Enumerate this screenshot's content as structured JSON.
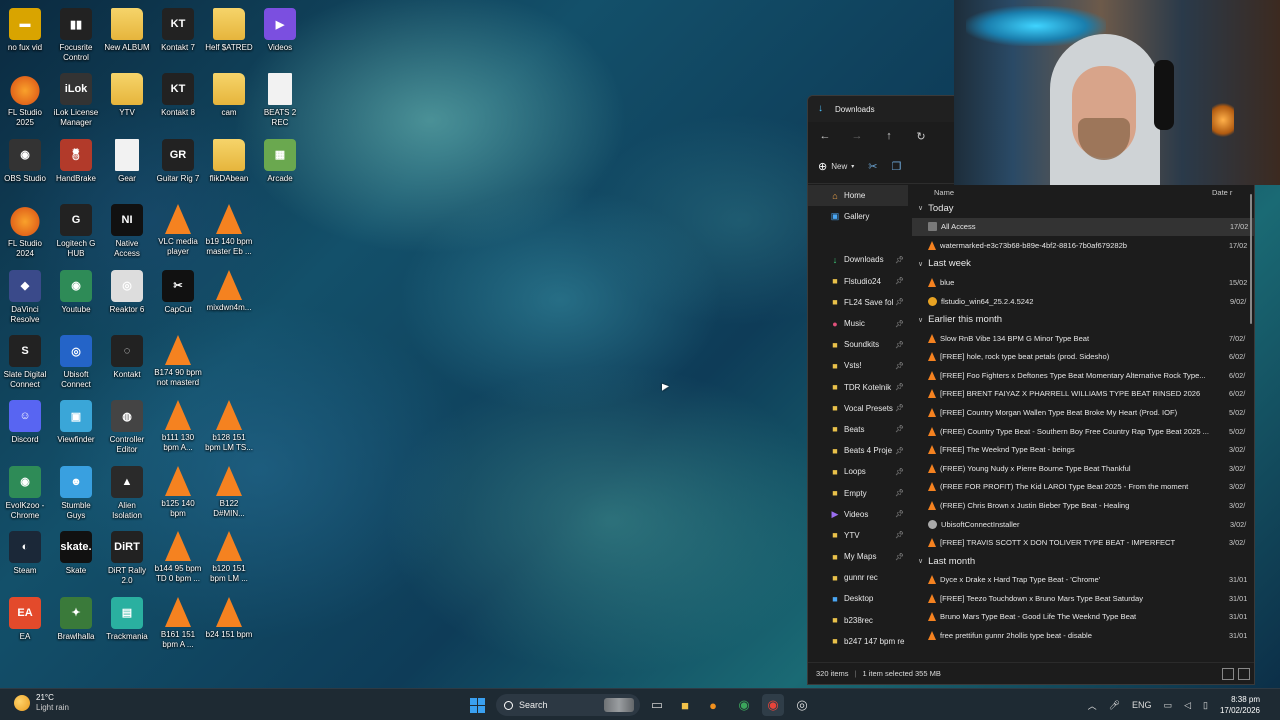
{
  "desktop": {
    "icons": [
      {
        "label": "no fux vid",
        "col": 0,
        "row": 0,
        "kind": "clap"
      },
      {
        "label": "Focusrite\nControl",
        "col": 1,
        "row": 0,
        "kind": "focus"
      },
      {
        "label": "New ALBUM",
        "col": 2,
        "row": 0,
        "kind": "folder"
      },
      {
        "label": "Kontakt 7",
        "col": 3,
        "row": 0,
        "kind": "kt"
      },
      {
        "label": "Helf $ATRED",
        "col": 4,
        "row": 0,
        "kind": "folder"
      },
      {
        "label": "Videos",
        "col": 5,
        "row": 0,
        "kind": "videos"
      },
      {
        "label": "FL Studio\n2025",
        "col": 0,
        "row": 1,
        "kind": "fl"
      },
      {
        "label": "iLok License\nManager",
        "col": 1,
        "row": 1,
        "kind": "ilok"
      },
      {
        "label": "YTV",
        "col": 2,
        "row": 1,
        "kind": "folder"
      },
      {
        "label": "Kontakt 8",
        "col": 3,
        "row": 1,
        "kind": "kt"
      },
      {
        "label": "cam",
        "col": 4,
        "row": 1,
        "kind": "folder"
      },
      {
        "label": "BEATS 2 REC",
        "col": 5,
        "row": 1,
        "kind": "file"
      },
      {
        "label": "OBS Studio",
        "col": 0,
        "row": 2,
        "kind": "obs"
      },
      {
        "label": "HandBrake",
        "col": 1,
        "row": 2,
        "kind": "handbrake"
      },
      {
        "label": "Gear",
        "col": 2,
        "row": 2,
        "kind": "file"
      },
      {
        "label": "Guitar Rig 7",
        "col": 3,
        "row": 2,
        "kind": "gr"
      },
      {
        "label": "flikDAbean",
        "col": 4,
        "row": 2,
        "kind": "folder"
      },
      {
        "label": "Arcade",
        "col": 5,
        "row": 2,
        "kind": "arcade"
      },
      {
        "label": "FL Studio\n2024",
        "col": 0,
        "row": 3,
        "kind": "fl"
      },
      {
        "label": "Logitech G\nHUB",
        "col": 1,
        "row": 3,
        "kind": "ghub"
      },
      {
        "label": "Native\nAccess",
        "col": 2,
        "row": 3,
        "kind": "ni"
      },
      {
        "label": "VLC media\nplayer",
        "col": 3,
        "row": 3,
        "kind": "vlc"
      },
      {
        "label": "b19 140 bpm\nmaster Eb ...",
        "col": 4,
        "row": 3,
        "kind": "vlc"
      },
      {
        "label": "DaVinci\nResolve",
        "col": 0,
        "row": 4,
        "kind": "davinci"
      },
      {
        "label": "Youtube",
        "col": 1,
        "row": 4,
        "kind": "chrome"
      },
      {
        "label": "Reaktor 6",
        "col": 2,
        "row": 4,
        "kind": "reaktor"
      },
      {
        "label": "CapCut",
        "col": 3,
        "row": 4,
        "kind": "capcut"
      },
      {
        "label": "mixdwn4m...",
        "col": 4,
        "row": 4,
        "kind": "vlc"
      },
      {
        "label": "Slate Digital\nConnect",
        "col": 0,
        "row": 5,
        "kind": "slate"
      },
      {
        "label": "Ubisoft\nConnect",
        "col": 1,
        "row": 5,
        "kind": "ubisoft"
      },
      {
        "label": "Kontakt",
        "col": 2,
        "row": 5,
        "kind": "kontakt"
      },
      {
        "label": "B174 90 bpm\nnot masterd",
        "col": 3,
        "row": 5,
        "kind": "vlc"
      },
      {
        "label": "Discord",
        "col": 0,
        "row": 6,
        "kind": "discord"
      },
      {
        "label": "Viewfinder",
        "col": 1,
        "row": 6,
        "kind": "viewfinder"
      },
      {
        "label": "Controller\nEditor",
        "col": 2,
        "row": 6,
        "kind": "controller"
      },
      {
        "label": "b111 130\nbpm A...",
        "col": 3,
        "row": 6,
        "kind": "vlc"
      },
      {
        "label": "b128 151\nbpm LM TS...",
        "col": 4,
        "row": 6,
        "kind": "vlc"
      },
      {
        "label": "EvolKzoo -\nChrome",
        "col": 0,
        "row": 7,
        "kind": "chrome"
      },
      {
        "label": "Stumble\nGuys",
        "col": 1,
        "row": 7,
        "kind": "stumble"
      },
      {
        "label": "Alien\nIsolation",
        "col": 2,
        "row": 7,
        "kind": "alien"
      },
      {
        "label": "b125 140\nbpm",
        "col": 3,
        "row": 7,
        "kind": "vlc"
      },
      {
        "label": "B122\nD#MIN...",
        "col": 4,
        "row": 7,
        "kind": "vlc"
      },
      {
        "label": "Steam",
        "col": 0,
        "row": 8,
        "kind": "steam"
      },
      {
        "label": "Skate",
        "col": 1,
        "row": 8,
        "kind": "skate"
      },
      {
        "label": "DiRT Rally 2.0",
        "col": 2,
        "row": 8,
        "kind": "dirt"
      },
      {
        "label": "b144 95 bpm\nTD 0 bpm ...",
        "col": 3,
        "row": 8,
        "kind": "vlc"
      },
      {
        "label": "b120 151\nbpm LM ...",
        "col": 4,
        "row": 8,
        "kind": "vlc"
      },
      {
        "label": "EA",
        "col": 0,
        "row": 9,
        "kind": "ea"
      },
      {
        "label": "Brawlhalla",
        "col": 1,
        "row": 9,
        "kind": "brawl"
      },
      {
        "label": "Trackmania",
        "col": 2,
        "row": 9,
        "kind": "trackmania"
      },
      {
        "label": "B161 151\nbpm A ...",
        "col": 3,
        "row": 9,
        "kind": "vlc"
      },
      {
        "label": "b24 151 bpm",
        "col": 4,
        "row": 9,
        "kind": "vlc"
      }
    ]
  },
  "explorer": {
    "title": "Downloads",
    "toolbar": {
      "new_label": "New"
    },
    "sidebar": [
      {
        "label": "Home",
        "icon": "home-icon",
        "glyph": "⌂",
        "color": "#f3a74a",
        "pinned": false,
        "selected": true
      },
      {
        "label": "Gallery",
        "icon": "gallery-icon",
        "glyph": "▣",
        "color": "#4aa6f3",
        "pinned": false
      },
      {
        "gap": true
      },
      {
        "label": "Downloads",
        "icon": "download-icon",
        "glyph": "↓",
        "color": "#3fd07c",
        "pinned": true
      },
      {
        "label": "Flstudio24",
        "icon": "folder-icon",
        "glyph": "■",
        "color": "#e9c14a",
        "pinned": true
      },
      {
        "label": "FL24 Save fol",
        "icon": "folder-icon",
        "glyph": "■",
        "color": "#e9c14a",
        "pinned": true
      },
      {
        "label": "Music",
        "icon": "music-icon",
        "glyph": "●",
        "color": "#e0507a",
        "pinned": true
      },
      {
        "label": "Soundkits",
        "icon": "folder-icon",
        "glyph": "■",
        "color": "#e9c14a",
        "pinned": true
      },
      {
        "label": "Vsts!",
        "icon": "folder-icon",
        "glyph": "■",
        "color": "#e9c14a",
        "pinned": true
      },
      {
        "label": "TDR Kotelnik",
        "icon": "folder-icon",
        "glyph": "■",
        "color": "#e9c14a",
        "pinned": true
      },
      {
        "label": "Vocal Presets",
        "icon": "folder-icon",
        "glyph": "■",
        "color": "#e9c14a",
        "pinned": true
      },
      {
        "label": "Beats",
        "icon": "folder-icon",
        "glyph": "■",
        "color": "#e9c14a",
        "pinned": true
      },
      {
        "label": "Beats 4 Proje",
        "icon": "folder-icon",
        "glyph": "■",
        "color": "#e9c14a",
        "pinned": true
      },
      {
        "label": "Loops",
        "icon": "folder-icon",
        "glyph": "■",
        "color": "#e9c14a",
        "pinned": true
      },
      {
        "label": "Empty",
        "icon": "folder-icon",
        "glyph": "■",
        "color": "#e9c14a",
        "pinned": true
      },
      {
        "label": "Videos",
        "icon": "videos-icon",
        "glyph": "▶",
        "color": "#9a6ef0",
        "pinned": true
      },
      {
        "label": "YTV",
        "icon": "folder-icon",
        "glyph": "■",
        "color": "#e9c14a",
        "pinned": true
      },
      {
        "label": "My Maps",
        "icon": "folder-icon",
        "glyph": "■",
        "color": "#e9c14a",
        "pinned": true
      },
      {
        "label": "gunnr rec",
        "icon": "folder-icon",
        "glyph": "■",
        "color": "#e9c14a",
        "pinned": false
      },
      {
        "label": "Desktop",
        "icon": "desktop-icon",
        "glyph": "■",
        "color": "#4aa6f3",
        "pinned": false
      },
      {
        "label": "b238rec",
        "icon": "folder-icon",
        "glyph": "■",
        "color": "#e9c14a",
        "pinned": false
      },
      {
        "label": "b247 147 bpm re",
        "icon": "folder-icon",
        "glyph": "■",
        "color": "#e9c14a",
        "pinned": false
      }
    ],
    "columns": {
      "name": "Name",
      "date": "Date r"
    },
    "groups": [
      {
        "label": "Today",
        "rows": [
          {
            "name": "All Access",
            "date": "17/02",
            "icon": "app",
            "selected": true
          },
          {
            "name": "watermarked-e3c73b68-b89e-4bf2-8816-7b0af679282b",
            "date": "17/02",
            "icon": "vlc"
          }
        ]
      },
      {
        "label": "Last week",
        "rows": [
          {
            "name": "blue",
            "date": "15/02",
            "icon": "vlc"
          },
          {
            "name": "flstudio_win64_25.2.4.5242",
            "date": "9/02/",
            "icon": "fl"
          }
        ]
      },
      {
        "label": "Earlier this month",
        "rows": [
          {
            "name": "Slow  RnB Vibe  134 BPM  G Minor  Type Beat",
            "date": "7/02/",
            "icon": "vlc"
          },
          {
            "name": "[FREE] hole, rock type beat petals (prod. Sidesho)",
            "date": "6/02/",
            "icon": "vlc"
          },
          {
            "name": "[FREE]  Foo Fighters x Deftones Type Beat  Momentary  Alternative Rock Type...",
            "date": "6/02/",
            "icon": "vlc"
          },
          {
            "name": "[FREE] BRENT FAIYAZ X PHARRELL WILLIAMS TYPE BEAT RINSED  2026",
            "date": "6/02/",
            "icon": "vlc"
          },
          {
            "name": "[FREE] Country Morgan Wallen Type Beat Broke My Heart (Prod. IOF)",
            "date": "5/02/",
            "icon": "vlc"
          },
          {
            "name": "(FREE) Country Type Beat - Southern Boy  Free Country Rap Type Beat 2025  ...",
            "date": "5/02/",
            "icon": "vlc"
          },
          {
            "name": "[FREE] The Weeknd Type Beat - beings",
            "date": "3/02/",
            "icon": "vlc"
          },
          {
            "name": "(FREE) Young Nudy x Pierre Bourne Type Beat Thankful",
            "date": "3/02/",
            "icon": "vlc"
          },
          {
            "name": "(FREE FOR PROFIT) The Kid LAROI Type Beat 2025 - From the moment",
            "date": "3/02/",
            "icon": "vlc"
          },
          {
            "name": "(FREE) Chris Brown x Justin Bieber Type Beat - Healing",
            "date": "3/02/",
            "icon": "vlc"
          },
          {
            "name": "UbisoftConnectInstaller",
            "date": "3/02/",
            "icon": "ubi"
          },
          {
            "name": "[FREE] TRAVIS SCOTT X DON TOLIVER TYPE BEAT - IMPERFECT",
            "date": "3/02/",
            "icon": "vlc"
          }
        ]
      },
      {
        "label": "Last month",
        "rows": [
          {
            "name": "Dyce x Drake x Hard Trap Type Beat - 'Chrome'",
            "date": "31/01",
            "icon": "vlc"
          },
          {
            "name": "[FREE] Teezo Touchdown x Bruno Mars Type Beat Saturday",
            "date": "31/01",
            "icon": "vlc"
          },
          {
            "name": "Bruno Mars Type Beat - Good Life  The Weeknd Type Beat",
            "date": "31/01",
            "icon": "vlc"
          },
          {
            "name": "free prettifun  gunnr  2hollis type beat - disable",
            "date": "31/01",
            "icon": "vlc"
          }
        ]
      }
    ],
    "status": {
      "count": "320 items",
      "selection": "1 item selected  355 MB"
    }
  },
  "taskbar": {
    "weather": {
      "temp": "21°C",
      "desc": "Light rain"
    },
    "search_label": "Search",
    "tray": {
      "lang": "ENG",
      "time": "8:38 pm",
      "date": "17/02/2026"
    }
  }
}
